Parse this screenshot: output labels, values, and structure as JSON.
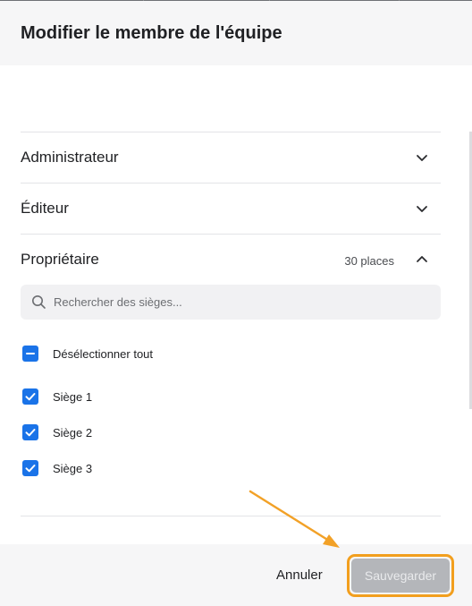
{
  "dialog": {
    "title": "Modifier le membre de l'équipe"
  },
  "roles": [
    {
      "label": "Administrateur",
      "expanded": false
    },
    {
      "label": "Éditeur",
      "expanded": false
    },
    {
      "label": "Propriétaire",
      "expanded": true,
      "count_text": "30 places"
    }
  ],
  "search": {
    "placeholder": "Rechercher des sièges...",
    "value": ""
  },
  "select_all": {
    "label": "Désélectionner tout",
    "state": "indeterminate"
  },
  "seats": [
    {
      "label": "Siège 1",
      "checked": true
    },
    {
      "label": "Siège 2",
      "checked": true
    },
    {
      "label": "Siège 3",
      "checked": true
    }
  ],
  "footer": {
    "cancel_label": "Annuler",
    "save_label": "Sauvegarder",
    "save_disabled": true
  },
  "colors": {
    "accent": "#1a73e8",
    "highlight": "#f29f1e",
    "disabled_button": "#b4b6ba"
  },
  "icons": [
    "chevron-down-icon",
    "chevron-up-icon",
    "search-icon",
    "check-icon",
    "minus-icon",
    "arrow-annotation"
  ]
}
